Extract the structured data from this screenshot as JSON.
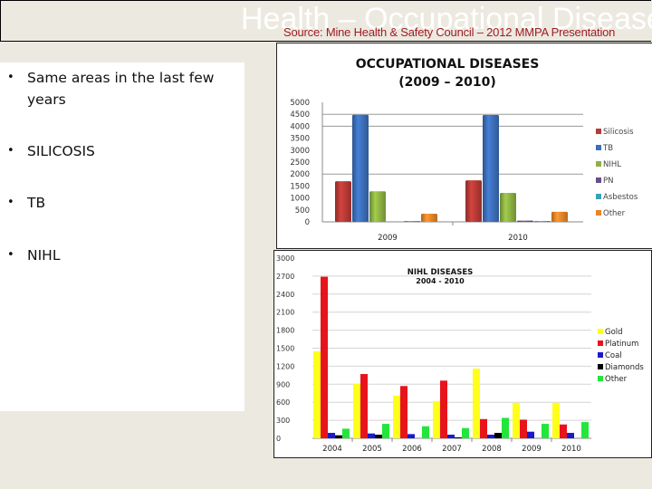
{
  "header": {
    "title": "Health – Occupational Diseases",
    "source": "Source: Mine Health & Safety Council – 2012 MMPA Presentation"
  },
  "bullets": [
    {
      "icon": "bullet-dot-icon",
      "text": "Same areas in the last few years"
    },
    {
      "icon": "bullet-dot-icon",
      "text": "SILICOSIS"
    },
    {
      "icon": "bullet-dot-icon",
      "text": "TB"
    },
    {
      "icon": "bullet-dot-icon",
      "text": "NIHL"
    }
  ],
  "chart_data": [
    {
      "type": "bar",
      "title": "OCCUPATIONAL DISEASES",
      "subtitle": "(2009 – 2010)",
      "xlabel": "",
      "ylabel": "",
      "categories": [
        "2009",
        "2010"
      ],
      "ylim": [
        0,
        5000
      ],
      "yticks": [
        0,
        500,
        1000,
        1500,
        2000,
        2500,
        3000,
        3500,
        4000,
        4500,
        5000
      ],
      "gridlines": [
        2000,
        4000,
        4500
      ],
      "legend_position": "right",
      "series": [
        {
          "name": "Silicosis",
          "color": "#b83a36",
          "values": [
            1700,
            1740
          ]
        },
        {
          "name": "TB",
          "color": "#3c6fba",
          "values": [
            4480,
            4470
          ]
        },
        {
          "name": "NIHL",
          "color": "#8db243",
          "values": [
            1280,
            1210
          ]
        },
        {
          "name": "PN",
          "color": "#6a4c8c",
          "values": [
            0,
            50
          ]
        },
        {
          "name": "Asbestos",
          "color": "#3aa2b8",
          "values": [
            20,
            15
          ]
        },
        {
          "name": "Other",
          "color": "#e9842a",
          "values": [
            340,
            420
          ]
        }
      ]
    },
    {
      "type": "bar",
      "title": "NIHL DISEASES",
      "subtitle": "2004 - 2010",
      "xlabel": "",
      "ylabel": "",
      "categories": [
        "2004",
        "2005",
        "2006",
        "2007",
        "2008",
        "2009",
        "2010"
      ],
      "ylim": [
        0,
        3000
      ],
      "yticks": [
        0,
        300,
        600,
        900,
        1200,
        1500,
        1800,
        2100,
        2400,
        2700,
        3000
      ],
      "gridlines": [
        0,
        300,
        600,
        900,
        1200,
        1500,
        1800,
        2100,
        2400,
        2700
      ],
      "legend_position": "right",
      "series": [
        {
          "name": "Gold",
          "color": "#ffff1a",
          "values": [
            1450,
            910,
            710,
            620,
            1160,
            590,
            590
          ]
        },
        {
          "name": "Platinum",
          "color": "#e8141c",
          "values": [
            2690,
            1070,
            870,
            960,
            320,
            310,
            230
          ]
        },
        {
          "name": "Coal",
          "color": "#1a1acc",
          "values": [
            90,
            80,
            70,
            60,
            60,
            110,
            90
          ]
        },
        {
          "name": "Diamonds",
          "color": "#000000",
          "values": [
            50,
            60,
            0,
            15,
            90,
            0,
            0
          ]
        },
        {
          "name": "Other",
          "color": "#22e63a",
          "values": [
            160,
            240,
            200,
            170,
            340,
            240,
            270
          ]
        }
      ]
    }
  ]
}
